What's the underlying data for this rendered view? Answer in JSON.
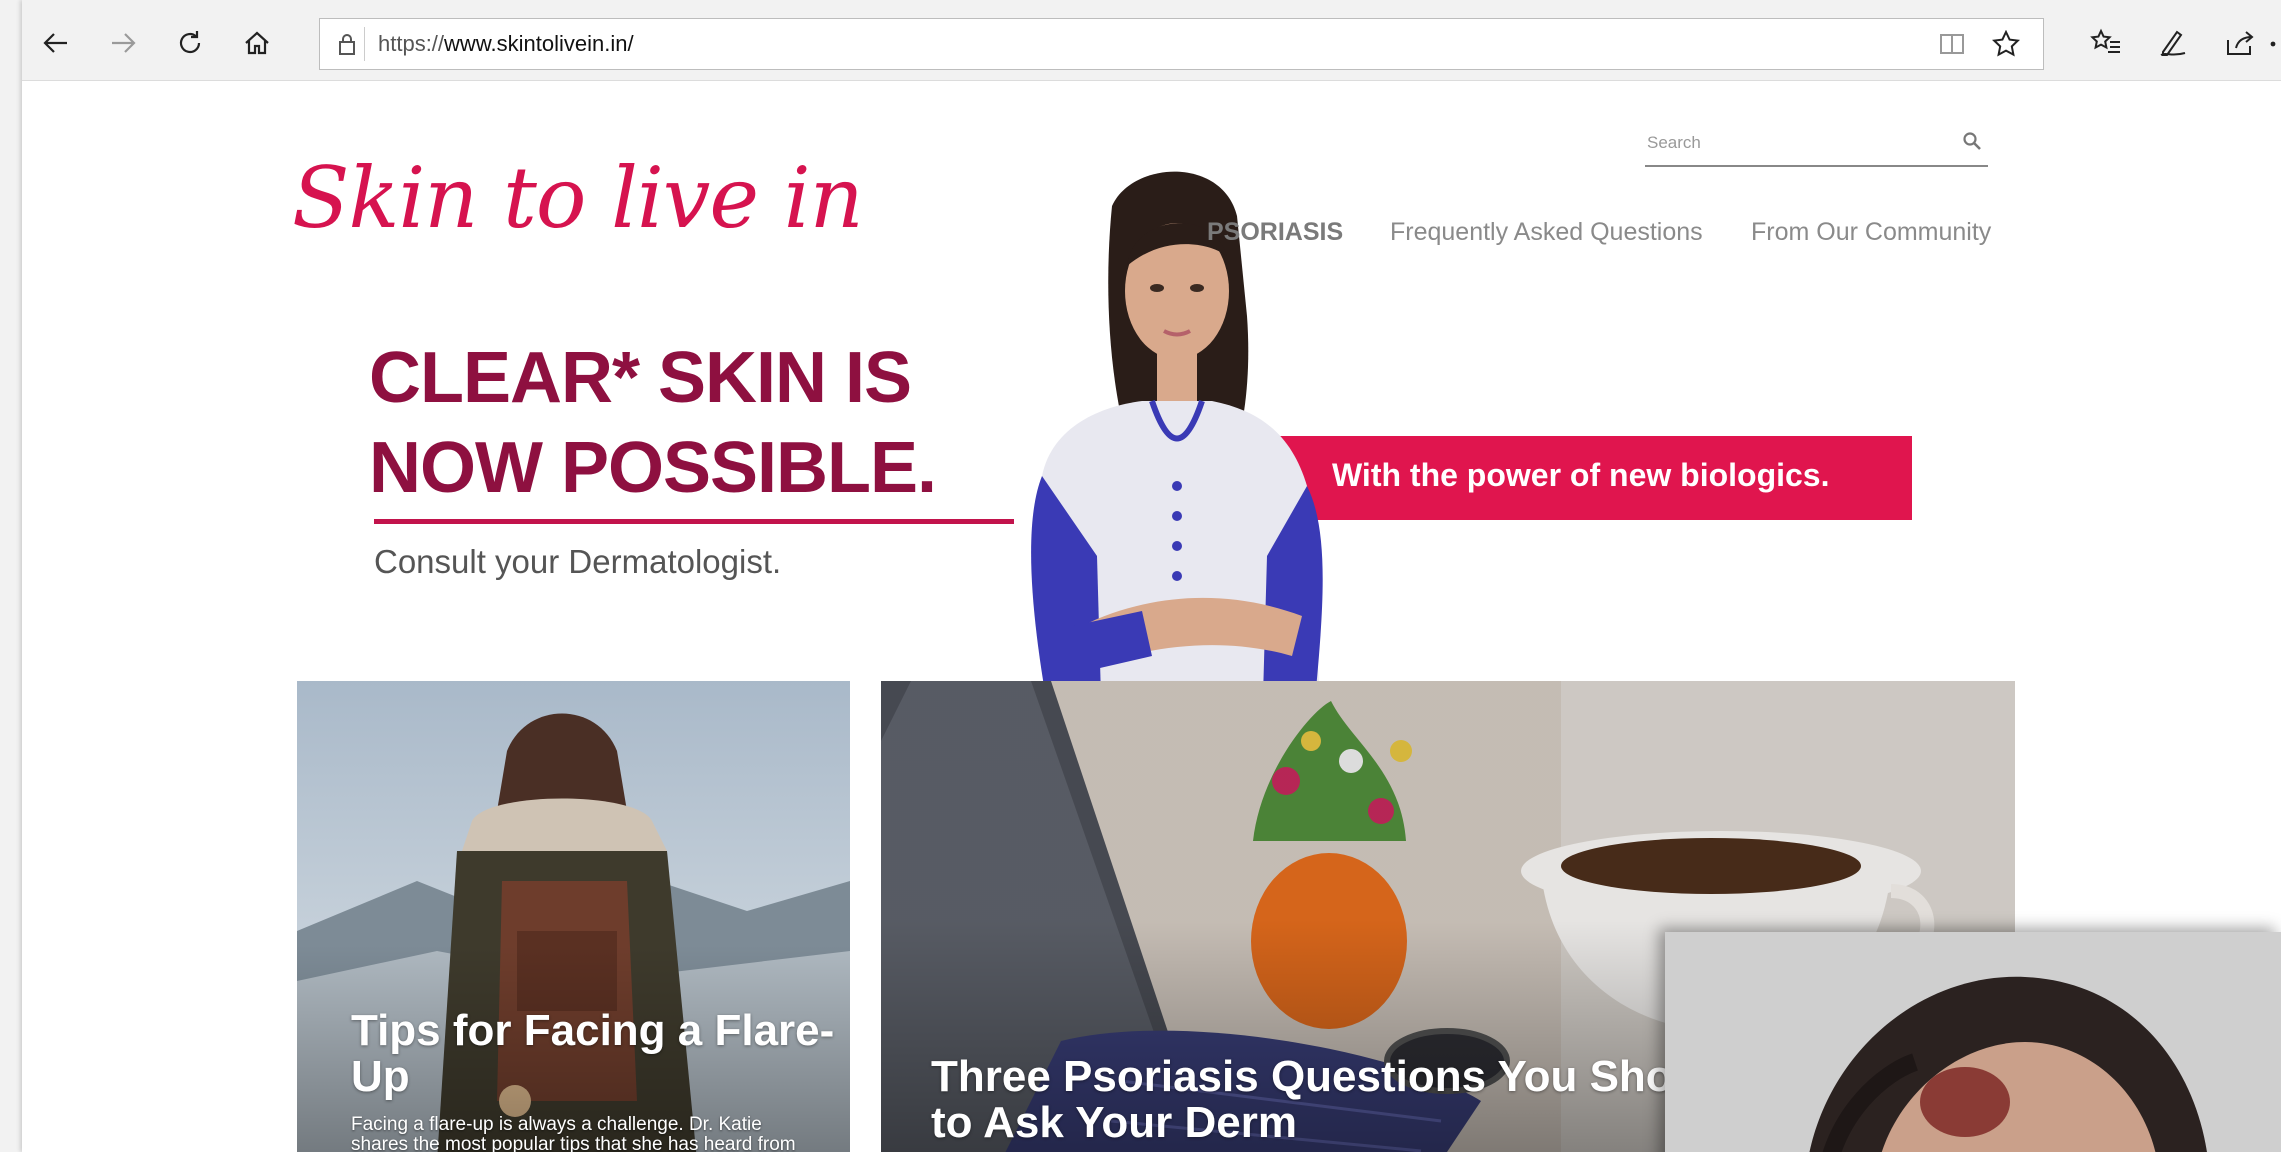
{
  "browser": {
    "url_protocol": "https://",
    "url_host": "www.skintolivein.in/",
    "icons": {
      "back": "back-arrow-icon",
      "forward": "forward-arrow-icon",
      "refresh": "refresh-icon",
      "home": "home-icon",
      "lock": "lock-icon",
      "reading_view": "reading-view-icon",
      "favorite": "star-icon",
      "favorites_list": "favorites-list-icon",
      "notes": "pen-icon",
      "share": "share-icon",
      "more": "more-icon"
    }
  },
  "site": {
    "logo": "Skin to live in",
    "search_placeholder": "Search",
    "nav": {
      "psoriasis": "PSORIASIS",
      "faq": "Frequently Asked Questions",
      "community": "From Our Community"
    }
  },
  "hero": {
    "line1": "CLEAR* SKIN IS",
    "line2": "NOW POSSIBLE.",
    "subline": "Consult your Dermatologist.",
    "band": "With the power of new biologics.",
    "colors": {
      "title": "#8e1040",
      "band": "#e0154e"
    }
  },
  "cards": [
    {
      "title": "Tips for Facing a Flare-Up",
      "title_l1": "Tips for Facing a Flare-",
      "title_l2": "Up",
      "desc_l1": "Facing a flare-up is always a challenge. Dr. Katie",
      "desc_l2": "shares the most popular tips that she has heard from"
    },
    {
      "title_l1": "Three Psoriasis Questions You Shou",
      "title_l2": "to Ask Your Derm"
    }
  ]
}
